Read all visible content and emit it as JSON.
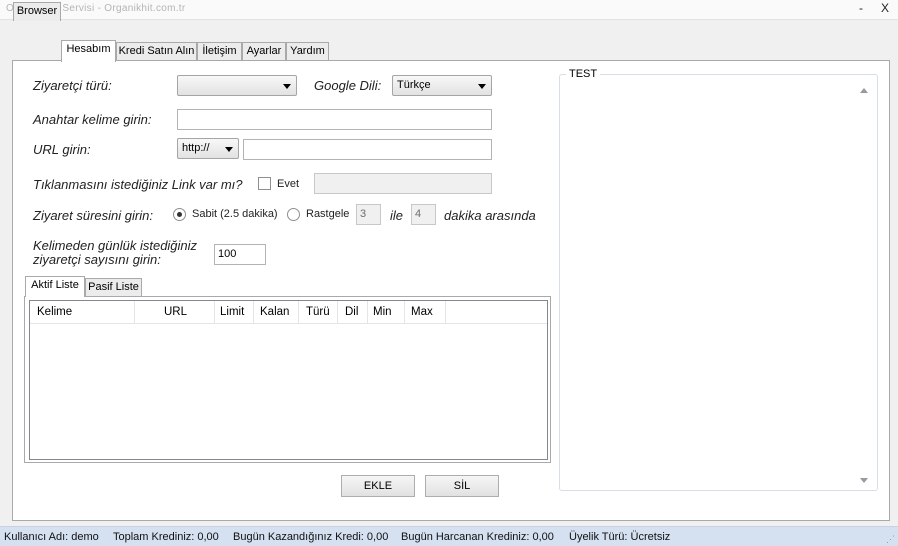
{
  "window": {
    "title": "Organik Hit Servisi - Organikhit.com.tr",
    "minimize_glyph": "-",
    "close_glyph": "X"
  },
  "tabs": [
    {
      "label": "Browser",
      "active": false
    },
    {
      "label": "Hesabım",
      "active": true
    },
    {
      "label": "Kredi Satın Alın",
      "active": false
    },
    {
      "label": "İletişim",
      "active": false
    },
    {
      "label": "Ayarlar",
      "active": false
    },
    {
      "label": "Yardım",
      "active": false
    }
  ],
  "form": {
    "visitor_type_label": "Ziyaretçi türü:",
    "visitor_type_value": "",
    "google_lang_label": "Google Dili:",
    "google_lang_value": "Türkçe",
    "keyword_label": "Anahtar kelime girin:",
    "keyword_value": "",
    "url_label": "URL girin:",
    "url_scheme_value": "http://",
    "url_value": "",
    "link_question_label": "Tıklanmasını istediğiniz Link var mı?",
    "link_checkbox_label": "Evet",
    "link_value": "",
    "duration_label": "Ziyaret süresini girin:",
    "duration_fixed_label": "Sabit (2.5 dakika)",
    "duration_random_label": "Rastgele",
    "duration_min_value": "3",
    "duration_between": "ile",
    "duration_max_value": "4",
    "duration_suffix": "dakika arasında",
    "daily_count_label_1": "Kelimeden günlük istediğiniz",
    "daily_count_label_2": "ziyaretçi sayısını girin:",
    "daily_count_value": "100"
  },
  "list_tabs": [
    {
      "label": "Aktif Liste",
      "active": true
    },
    {
      "label": "Pasif Liste",
      "active": false
    }
  ],
  "list_columns": [
    "Kelime",
    "URL",
    "Limit",
    "Kalan",
    "Türü",
    "Dil",
    "Min",
    "Max"
  ],
  "buttons": {
    "add_label": "EKLE",
    "delete_label": "SİL"
  },
  "test_panel": {
    "title": "TEST"
  },
  "status": {
    "username": "Kullanıcı Adı: demo",
    "total_credit": "Toplam Krediniz: 0,00",
    "earned_today": "Bugün Kazandığınız Kredi: 0,00",
    "spent_today": "Bugün Harcanan Krediniz: 0,00",
    "membership": "Üyelik Türü: Ücretsiz"
  }
}
